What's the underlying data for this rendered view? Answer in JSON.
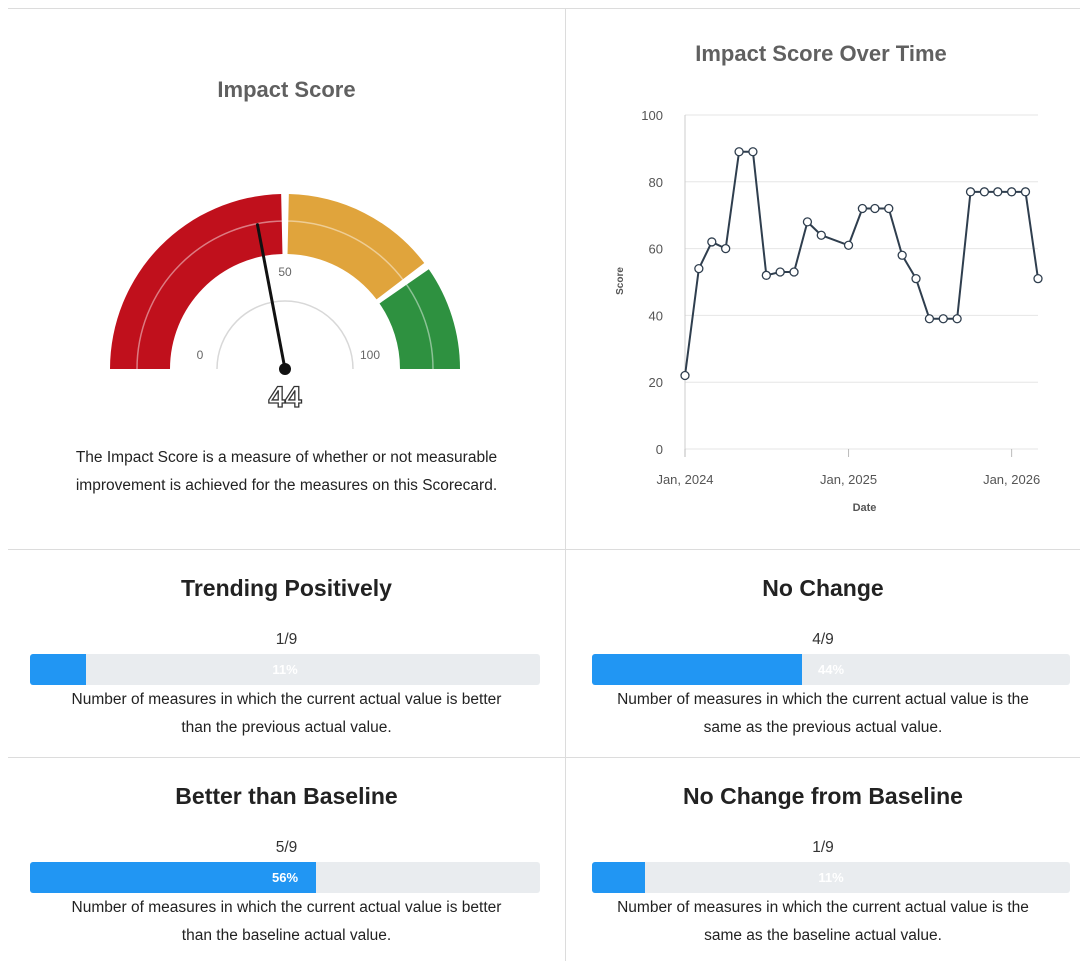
{
  "gauge": {
    "title": "Impact Score",
    "value": 44,
    "value_label": "44",
    "min": 0,
    "max": 100,
    "min_label": "0",
    "mid_label": "50",
    "max_label": "100",
    "bands": [
      {
        "from": 0,
        "to": 50,
        "color": "#c0101c"
      },
      {
        "from": 50,
        "to": 80,
        "color": "#e0a43c"
      },
      {
        "from": 80,
        "to": 100,
        "color": "#2e9140"
      }
    ],
    "description_line1": "The Impact Score is a measure of whether or not measurable",
    "description_line2": "improvement is achieved for the measures on this Scorecard."
  },
  "chart_data": {
    "type": "line",
    "title": "Impact Score Over Time",
    "xlabel": "Date",
    "ylabel": "Score",
    "ylim": [
      0,
      100
    ],
    "yticks": [
      0,
      20,
      40,
      60,
      80,
      100
    ],
    "xticks": [
      {
        "label": "Jan, 2024",
        "date": "2024-01-01"
      },
      {
        "label": "Jan, 2025",
        "date": "2025-01-01"
      },
      {
        "label": "Jan, 2026",
        "date": "2026-01-01"
      }
    ],
    "grid": true,
    "line_color": "#2f3e4e",
    "series": [
      {
        "x": [
          "2024-01-01",
          "2024-02-01",
          "2024-03-01",
          "2024-04-01",
          "2024-05-01",
          "2024-06-01",
          "2024-07-01",
          "2024-08-01",
          "2024-09-01",
          "2024-10-01",
          "2024-11-01",
          "2025-01-01",
          "2025-02-01",
          "2025-03-01",
          "2025-04-01",
          "2025-05-01",
          "2025-06-01",
          "2025-07-01",
          "2025-08-01",
          "2025-09-01",
          "2025-10-01",
          "2025-11-01",
          "2025-12-01",
          "2026-01-01",
          "2026-02-01",
          "2026-03-01"
        ],
        "values": [
          22,
          54,
          62,
          60,
          89,
          89,
          52,
          53,
          53,
          68,
          64,
          61,
          72,
          72,
          72,
          58,
          51,
          39,
          39,
          39,
          77,
          77,
          77,
          77,
          77,
          51
        ]
      }
    ]
  },
  "stats": [
    {
      "title": "Trending Positively",
      "fraction": "1/9",
      "percent": 11,
      "percent_label": "11%",
      "desc_line1": "Number of measures in which the current actual value is better",
      "desc_line2": "than the previous actual value."
    },
    {
      "title": "No Change",
      "fraction": "4/9",
      "percent": 44,
      "percent_label": "44%",
      "desc_line1": "Number of measures in which the current actual value is the",
      "desc_line2": "same as the previous actual value."
    },
    {
      "title": "Better than Baseline",
      "fraction": "5/9",
      "percent": 56,
      "percent_label": "56%",
      "desc_line1": "Number of measures in which the current actual value is better",
      "desc_line2": "than the baseline actual value."
    },
    {
      "title": "No Change from Baseline",
      "fraction": "1/9",
      "percent": 11,
      "percent_label": "11%",
      "desc_line1": "Number of measures in which the current actual value is the",
      "desc_line2": "same as the baseline actual value."
    }
  ],
  "colors": {
    "progress_fill": "#2196f3",
    "title_gray": "#606060"
  }
}
